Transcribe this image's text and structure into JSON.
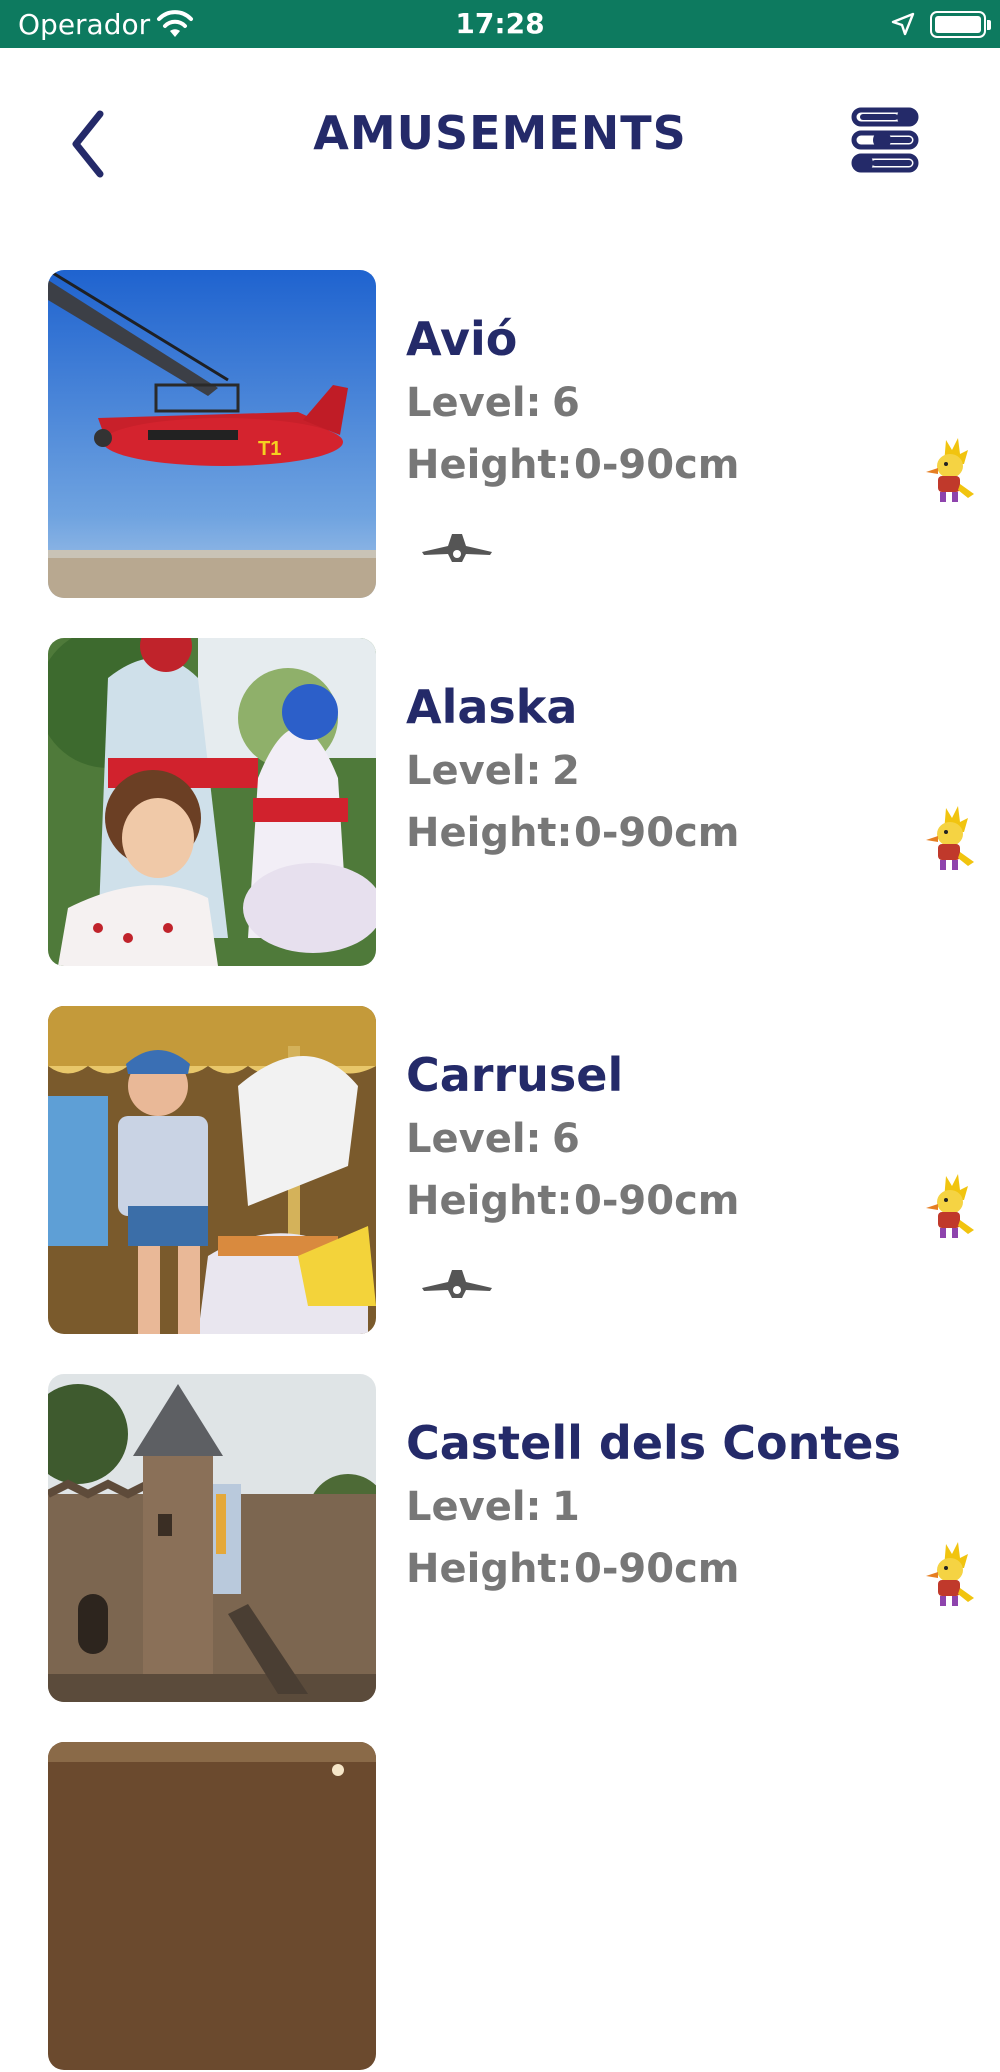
{
  "status_bar": {
    "carrier": "Operador",
    "time": "17:28"
  },
  "header": {
    "title": "AMUSEMENTS"
  },
  "colors": {
    "status_bar": "#0d7a5f",
    "primary": "#242a69",
    "secondary_text": "#777777"
  },
  "icons": {
    "back": "chevron-left-icon",
    "filter": "filter-sliders-icon",
    "plane": "plane-icon",
    "mascot": "mascot-icon"
  },
  "list": {
    "level_label": "Level:",
    "height_label": "Height:",
    "items": [
      {
        "name": "Avió",
        "level": "6",
        "height": "0-90cm",
        "has_plane_icon": true
      },
      {
        "name": "Alaska",
        "level": "2",
        "height": "0-90cm",
        "has_plane_icon": false
      },
      {
        "name": "Carrusel",
        "level": "6",
        "height": "0-90cm",
        "has_plane_icon": true
      },
      {
        "name": "Castell dels Contes",
        "level": "1",
        "height": "0-90cm",
        "has_plane_icon": false
      }
    ]
  }
}
